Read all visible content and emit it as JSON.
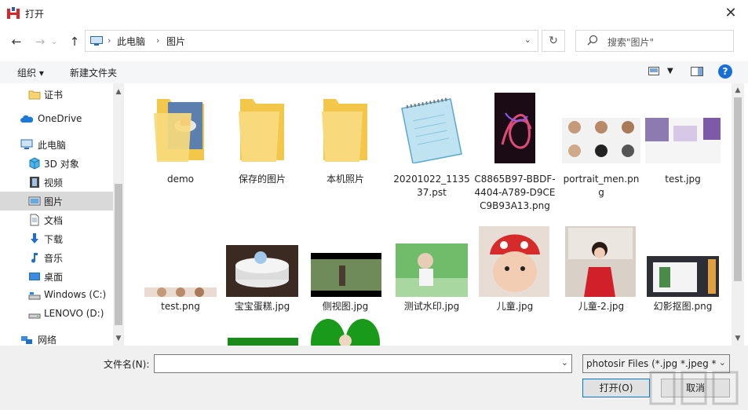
{
  "window": {
    "title": "打开",
    "close_symbol": "✕"
  },
  "nav": {
    "back_symbol": "←",
    "forward_symbol": "→",
    "recent_symbol": "⌄",
    "up_symbol": "↑",
    "breadcrumb": [
      "此电脑",
      "图片"
    ],
    "refresh_symbol": "↻",
    "search_placeholder": "搜索\"图片\""
  },
  "toolbar": {
    "organize": "组织 ▾",
    "new_folder": "新建文件夹",
    "help": "?"
  },
  "sidebar": {
    "items": [
      {
        "label": "证书",
        "icon": "folder-icon"
      },
      {
        "label": "OneDrive",
        "icon": "cloud-icon"
      },
      {
        "label": "此电脑",
        "icon": "computer-icon"
      },
      {
        "label": "3D 对象",
        "icon": "cube-icon"
      },
      {
        "label": "视频",
        "icon": "film-icon"
      },
      {
        "label": "图片",
        "icon": "picture-icon"
      },
      {
        "label": "文档",
        "icon": "document-icon"
      },
      {
        "label": "下载",
        "icon": "download-icon"
      },
      {
        "label": "音乐",
        "icon": "music-icon"
      },
      {
        "label": "桌面",
        "icon": "desktop-icon"
      },
      {
        "label": "Windows (C:)",
        "icon": "drive-icon"
      },
      {
        "label": "LENOVO (D:)",
        "icon": "drive-icon"
      },
      {
        "label": "网络",
        "icon": "network-icon"
      }
    ],
    "selected": "图片"
  },
  "files": [
    {
      "name": "demo",
      "kind": "folder"
    },
    {
      "name": "保存的图片",
      "kind": "folder"
    },
    {
      "name": "本机照片",
      "kind": "folder"
    },
    {
      "name": "20201022_113537.pst",
      "kind": "notepad"
    },
    {
      "name": "C8865B97-BBDF-4404-A789-D9CEC9B93A13.png",
      "kind": "image"
    },
    {
      "name": "portrait_men.png",
      "kind": "image"
    },
    {
      "name": "test.jpg",
      "kind": "image"
    },
    {
      "name": "test.png",
      "kind": "image"
    },
    {
      "name": "宝宝蛋糕.jpg",
      "kind": "image"
    },
    {
      "name": "侧视图.jpg",
      "kind": "image"
    },
    {
      "name": "测试水印.jpg",
      "kind": "image"
    },
    {
      "name": "儿童.jpg",
      "kind": "image"
    },
    {
      "name": "儿童-2.jpg",
      "kind": "image"
    },
    {
      "name": "幻影抠图.png",
      "kind": "image"
    }
  ],
  "footer": {
    "filename_label": "文件名(N):",
    "filename_value": "",
    "filter_value": "photosir Files (*.jpg *.jpeg *",
    "open_button": "打开(O)",
    "cancel_button": "取消"
  }
}
